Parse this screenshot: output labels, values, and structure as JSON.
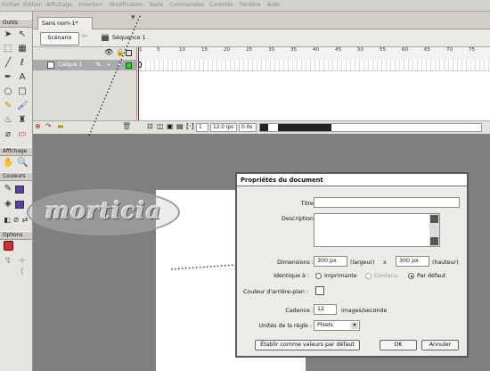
{
  "menu": [
    "Fichier",
    "Édition",
    "Affichage",
    "Insertion",
    "Modification",
    "Texte",
    "Commandes",
    "Contrôle",
    "Fenêtre",
    "Aide"
  ],
  "tools": {
    "title": "Outils",
    "section_view": "Affichage",
    "section_colors": "Couleurs",
    "section_options": "Options"
  },
  "document": {
    "tab_title": "Sans nom-1*",
    "scene_button": "Scénario",
    "sequence_label": "Séquence 1"
  },
  "timeline": {
    "layer_name": "Calque 1",
    "ruler_ticks": [
      "1",
      "5",
      "10",
      "15",
      "20",
      "25",
      "30",
      "35",
      "40",
      "45",
      "50",
      "55",
      "60",
      "65",
      "70",
      "75"
    ],
    "current_frame": "1",
    "fps": "12.0 ips",
    "elapsed": "0.0s"
  },
  "dialog": {
    "title": "Propriétés du document",
    "title_label": "Titre:",
    "title_value": "",
    "description_label": "Description:",
    "description_value": "",
    "dimensions_label": "Dimensions :",
    "width_value": "300 px",
    "width_unit": "(largeur)",
    "times": "x",
    "height_value": "300 px",
    "height_unit": "(hauteur)",
    "match_label": "Identique à :",
    "match_options": [
      "Imprimante",
      "Contenu",
      "Par défaut"
    ],
    "match_selected": "Par défaut",
    "bg_label": "Couleur d'arrière-plan :",
    "bg_color": "#ffffff",
    "framerate_label": "Cadence :",
    "framerate_value": "12",
    "framerate_unit": "images/seconde",
    "ruler_label": "Unités de la règle :",
    "ruler_value": "Pixels",
    "default_button": "Établir comme valeurs par défaut",
    "ok_button": "OK",
    "cancel_button": "Annuler"
  },
  "watermark": "morticia"
}
